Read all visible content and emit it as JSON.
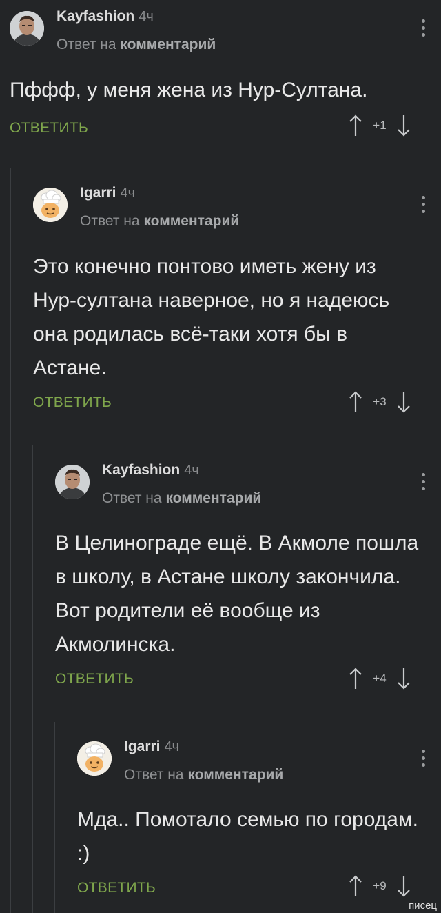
{
  "comments": [
    {
      "author": "Kayfashion",
      "time": "4ч",
      "reply_prefix": "Ответ на",
      "reply_target": "комментарий",
      "text": "Пффф, у меня жена из Нур-Султана.",
      "reply_label": "ОТВЕТИТЬ",
      "score": "+1",
      "avatar_icon": "man-portrait-avatar"
    },
    {
      "author": "Igarri",
      "time": "4ч",
      "reply_prefix": "Ответ на",
      "reply_target": "комментарий",
      "text": "Это конечно понтово иметь жену из Нур-султана наверное, но я надеюсь она родилась всё-таки хотя бы в Астане.",
      "reply_label": "ОТВЕТИТЬ",
      "score": "+3",
      "avatar_icon": "chef-cartoon-avatar"
    },
    {
      "author": "Kayfashion",
      "time": "4ч",
      "reply_prefix": "Ответ на",
      "reply_target": "комментарий",
      "text": "В Целинограде ещё. В Акмоле пошла в школу, в Астане школу закончила. Вот родители её вообще из Акмолинска.",
      "reply_label": "ОТВЕТИТЬ",
      "score": "+4",
      "avatar_icon": "man-portrait-avatar"
    },
    {
      "author": "Igarri",
      "time": "4ч",
      "reply_prefix": "Ответ на",
      "reply_target": "комментарий",
      "text": "Мда.. Помотало семью по городам. :)",
      "reply_label": "ОТВЕТИТЬ",
      "score": "+9",
      "avatar_icon": "chef-cartoon-avatar"
    }
  ],
  "watermark": "писец",
  "colors": {
    "background": "#232527",
    "reply_action": "#7fa64c",
    "thread_line": "#3b3e41"
  }
}
